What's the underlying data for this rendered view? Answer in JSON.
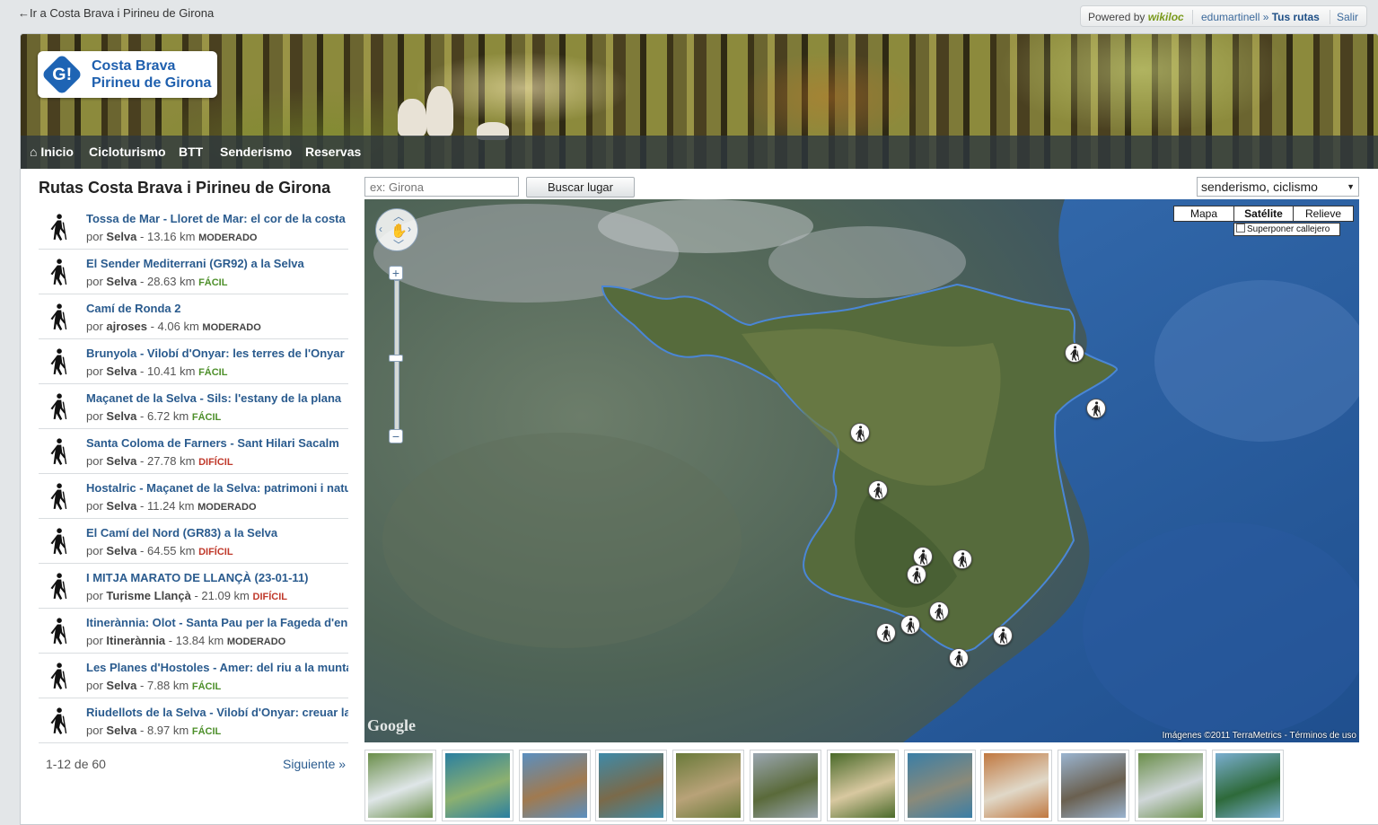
{
  "top_bar": {
    "back_arrow": "←",
    "back_link_prefix": "Ir a ",
    "back_link_name": "Costa Brava i Pirineu de Girona",
    "powered_by_label": "Powered by",
    "wikiloc_brand": "wikiloc",
    "username": "edumartinell",
    "user_sep": " » ",
    "my_routes": "Tus rutas",
    "logout": "Salir"
  },
  "header": {
    "logo_mark": "G!",
    "logo_line1": "Costa Brava",
    "logo_line2": "Pirineu de Girona",
    "brand_color": "#1e64b4"
  },
  "nav": {
    "home_icon": "⌂",
    "items": [
      "Inicio",
      "Cicloturismo",
      "BTT",
      "Senderismo",
      "Reservas"
    ]
  },
  "panel": {
    "title": "Rutas Costa Brava i Pirineu de Girona",
    "by_label": "por",
    "routes": [
      {
        "name": "Tossa de Mar - Lloret de Mar: el cor de la costa",
        "author": "Selva",
        "distance": "13.16 km",
        "difficulty": "MODERADO",
        "level": "moderado"
      },
      {
        "name": "El Sender Mediterrani (GR92) a la Selva",
        "author": "Selva",
        "distance": "28.63 km",
        "difficulty": "FÁCIL",
        "level": "facil"
      },
      {
        "name": "Camí de Ronda 2",
        "author": "ajroses",
        "distance": "4.06 km",
        "difficulty": "MODERADO",
        "level": "moderado"
      },
      {
        "name": "Brunyola - Vilobí d'Onyar: les terres de l'Onyar",
        "author": "Selva",
        "distance": "10.41 km",
        "difficulty": "FÁCIL",
        "level": "facil"
      },
      {
        "name": "Maçanet de la Selva - Sils: l'estany de la plana",
        "author": "Selva",
        "distance": "6.72 km",
        "difficulty": "FÁCIL",
        "level": "facil"
      },
      {
        "name": "Santa Coloma de Farners - Sant Hilari Sacalm",
        "author": "Selva",
        "distance": "27.78 km",
        "difficulty": "DIFÍCIL",
        "level": "dificil"
      },
      {
        "name": "Hostalric - Maçanet de la Selva: patrimoni i natura",
        "author": "Selva",
        "distance": "11.24 km",
        "difficulty": "MODERADO",
        "level": "moderado"
      },
      {
        "name": "El Camí del Nord (GR83) a la Selva",
        "author": "Selva",
        "distance": "64.55 km",
        "difficulty": "DIFÍCIL",
        "level": "dificil"
      },
      {
        "name": "I MITJA MARATO DE LLANÇÀ (23-01-11)",
        "author": "Turisme Llançà",
        "distance": "21.09 km",
        "difficulty": "DIFÍCIL",
        "level": "dificil"
      },
      {
        "name": "Itinerànnia: Olot - Santa Pau per la Fageda d'en Jordà",
        "author": "Itinerànnia",
        "distance": "13.84 km",
        "difficulty": "MODERADO",
        "level": "moderado"
      },
      {
        "name": "Les Planes d'Hostoles - Amer: del riu a la muntanya",
        "author": "Selva",
        "distance": "7.88 km",
        "difficulty": "FÁCIL",
        "level": "facil"
      },
      {
        "name": "Riudellots de la Selva - Vilobí d'Onyar: creuar la plana",
        "author": "Selva",
        "distance": "8.97 km",
        "difficulty": "FÁCIL",
        "level": "facil"
      }
    ],
    "difficulty_colors": {
      "facil": "#4d8f2a",
      "moderado": "#444444",
      "dificil": "#c0392b"
    },
    "pager_count": "1-12 de 60",
    "pager_next": "Siguiente »"
  },
  "map_tools": {
    "search_placeholder": "ex: Girona",
    "search_button": "Buscar lugar",
    "activity_select": "senderismo, ciclismo"
  },
  "map": {
    "map_types": [
      "Mapa",
      "Satélite",
      "Relieve"
    ],
    "active_map_type": "Satélite",
    "overlay_label": "Superponer callejero",
    "zoom_in": "+",
    "zoom_out": "−",
    "google_logo": "Google",
    "attribution": "Imágenes ©2011 TerraMetrics - Términos de uso",
    "marker_icon": "hiker-icon",
    "marker_count": 13
  },
  "thumbnails": {
    "count": 12,
    "colors": [
      [
        "#6a8e4a",
        "#dfe6e8"
      ],
      [
        "#2a7fa0",
        "#8cb070"
      ],
      [
        "#5a8fc0",
        "#a07a50"
      ],
      [
        "#3e8aa8",
        "#7a6a4a"
      ],
      [
        "#6a7a3a",
        "#b8a278"
      ],
      [
        "#9aa6b0",
        "#5a6a3a"
      ],
      [
        "#4a6a2a",
        "#d8c8a0"
      ],
      [
        "#3a7ea6",
        "#8a8a7a"
      ],
      [
        "#c07840",
        "#e0d8c8"
      ],
      [
        "#9ab4d0",
        "#6a6050"
      ],
      [
        "#6a8e4a",
        "#cfd6d8"
      ],
      [
        "#7aaed0",
        "#2e6a3a"
      ]
    ]
  }
}
